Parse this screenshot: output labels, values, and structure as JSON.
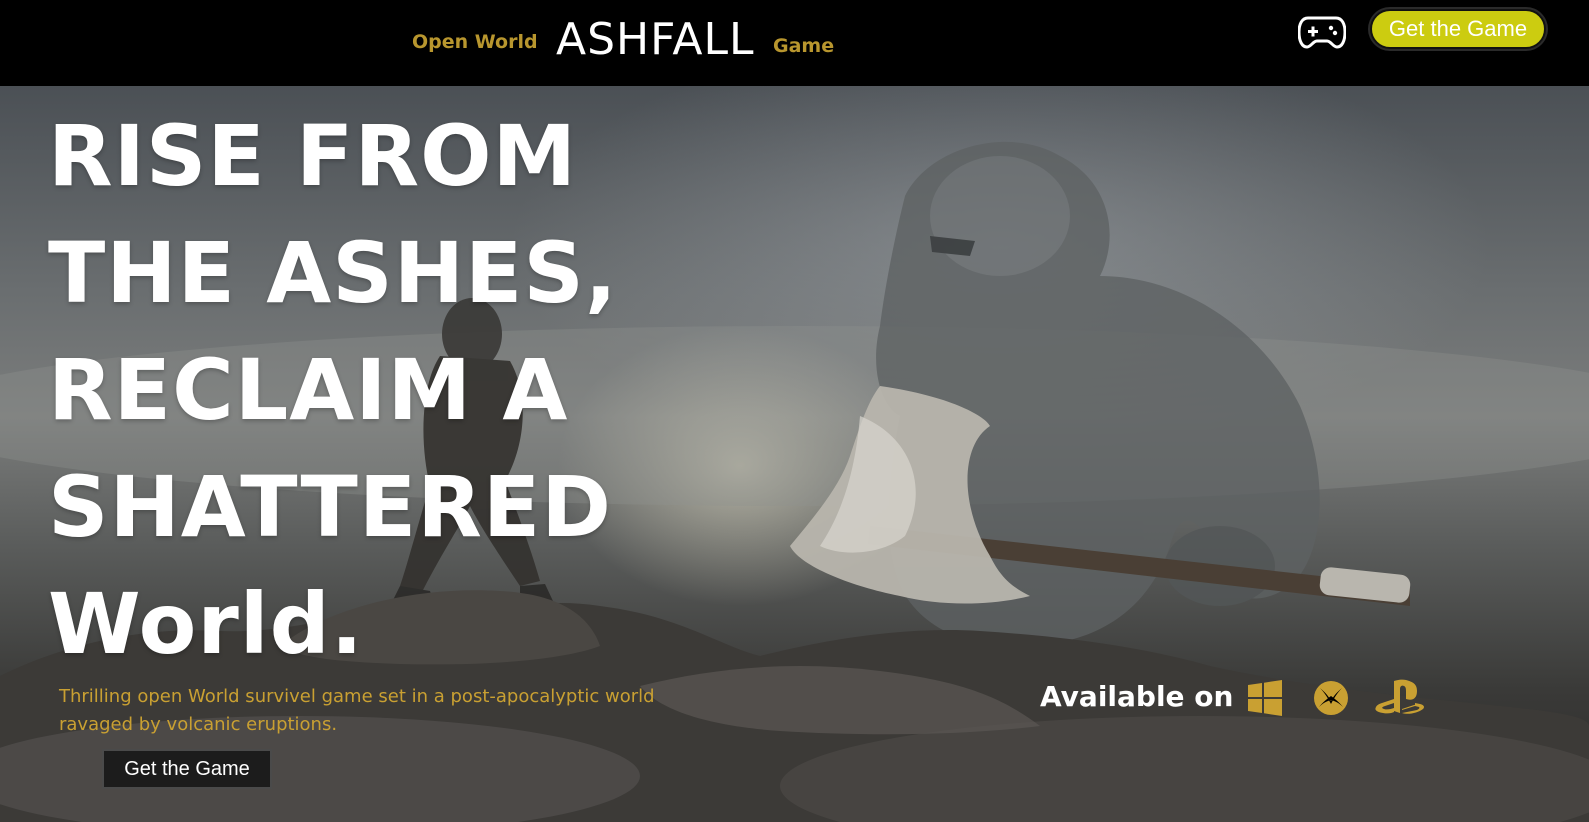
{
  "colors": {
    "accent_gold": "#c9a032",
    "cta_yellow": "#cccc10",
    "nav_bg": "#000000",
    "text_white": "#ffffff"
  },
  "nav": {
    "left_link": "Open World",
    "brand": "ASHFALL",
    "right_link": "Game",
    "controller_icon": "gamepad-icon",
    "cta_label": "Get the Game"
  },
  "hero": {
    "headline": "RISE FROM THE ASHES, RECLAIM A SHATTERED World.",
    "tagline": "Thrilling open World survivel game set in a post-apocalyptic world ravaged by volcanic eruptions.",
    "cta_label": "Get the Game",
    "available_label": "Available on",
    "platforms": [
      "windows-icon",
      "xbox-icon",
      "playstation-icon"
    ]
  }
}
